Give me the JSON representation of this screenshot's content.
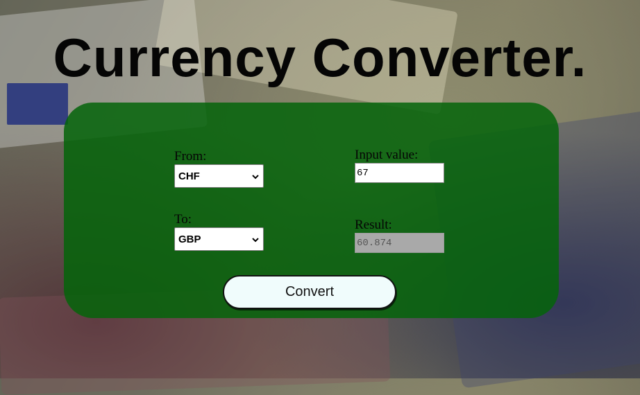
{
  "page": {
    "title": "Currency Converter."
  },
  "form": {
    "from_label": "From:",
    "from_value": "CHF",
    "to_label": "To:",
    "to_value": "GBP",
    "input_label": "Input value:",
    "input_value": "67",
    "result_label": "Result:",
    "result_value": "60.874",
    "convert_label": "Convert"
  },
  "colors": {
    "panel": "#05640a",
    "button": "#f0fcfc",
    "result_field": "#a9a9a9"
  }
}
